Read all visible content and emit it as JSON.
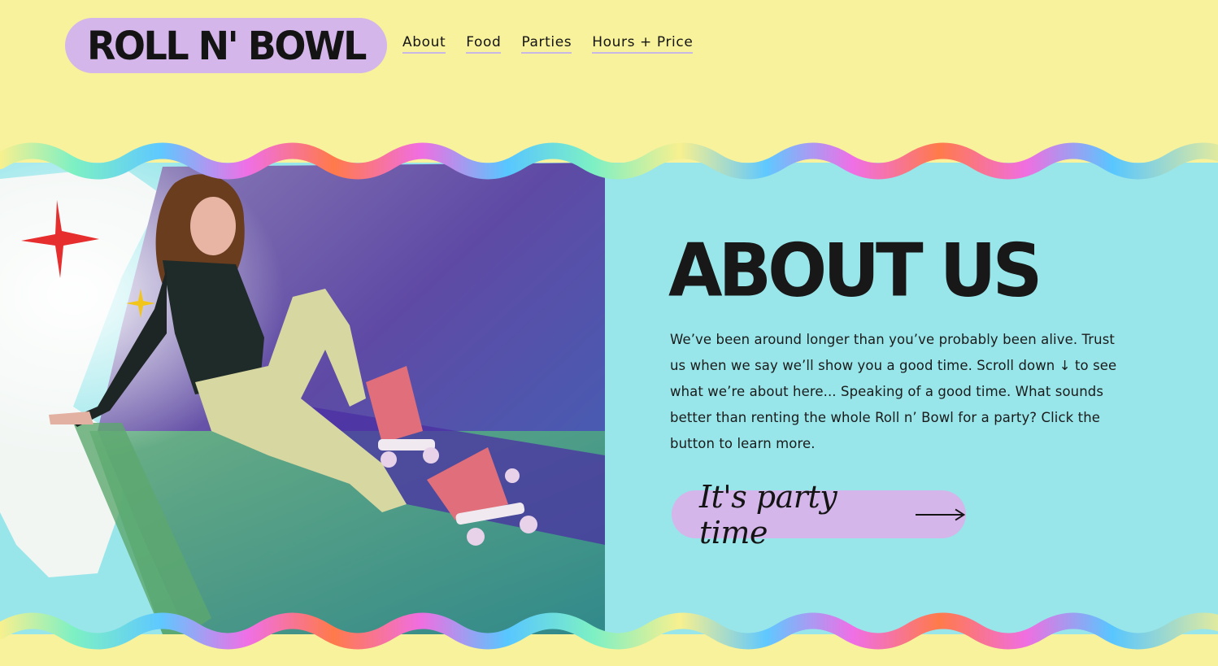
{
  "brand": {
    "logo": "ROLL N' BOWL"
  },
  "nav": {
    "items": [
      {
        "label": "About"
      },
      {
        "label": "Food"
      },
      {
        "label": "Parties"
      },
      {
        "label": "Hours + Price"
      }
    ]
  },
  "about": {
    "title": "ABOUT US",
    "body": "We’ve been around longer than you’ve probably been alive. Trust us when we say we’ll show you a good time. Scroll down ↓ to see what we’re about here... Speaking of a good time. What sounds better than renting the whole Roll n’ Bowl for a party? Click the button to learn more.",
    "cta_label": "It's party time"
  },
  "hero_image": {
    "subject": "woman-on-roller-skates"
  },
  "colors": {
    "header_bg": "#f8f29c",
    "main_bg": "#98e6ea",
    "pill": "#d4b6ea",
    "text": "#141414",
    "nav_underline": "#c8b8e6",
    "wave": [
      "#f7f08f",
      "#7df0c4",
      "#5fc8ff",
      "#ef6fe6",
      "#ff7a4a",
      "#f06ee0",
      "#58c6ff"
    ]
  },
  "icons": [
    "sparkle-icon-red",
    "sparkle-icon-yellow",
    "arrow-right-icon",
    "arrow-down-glyph"
  ]
}
